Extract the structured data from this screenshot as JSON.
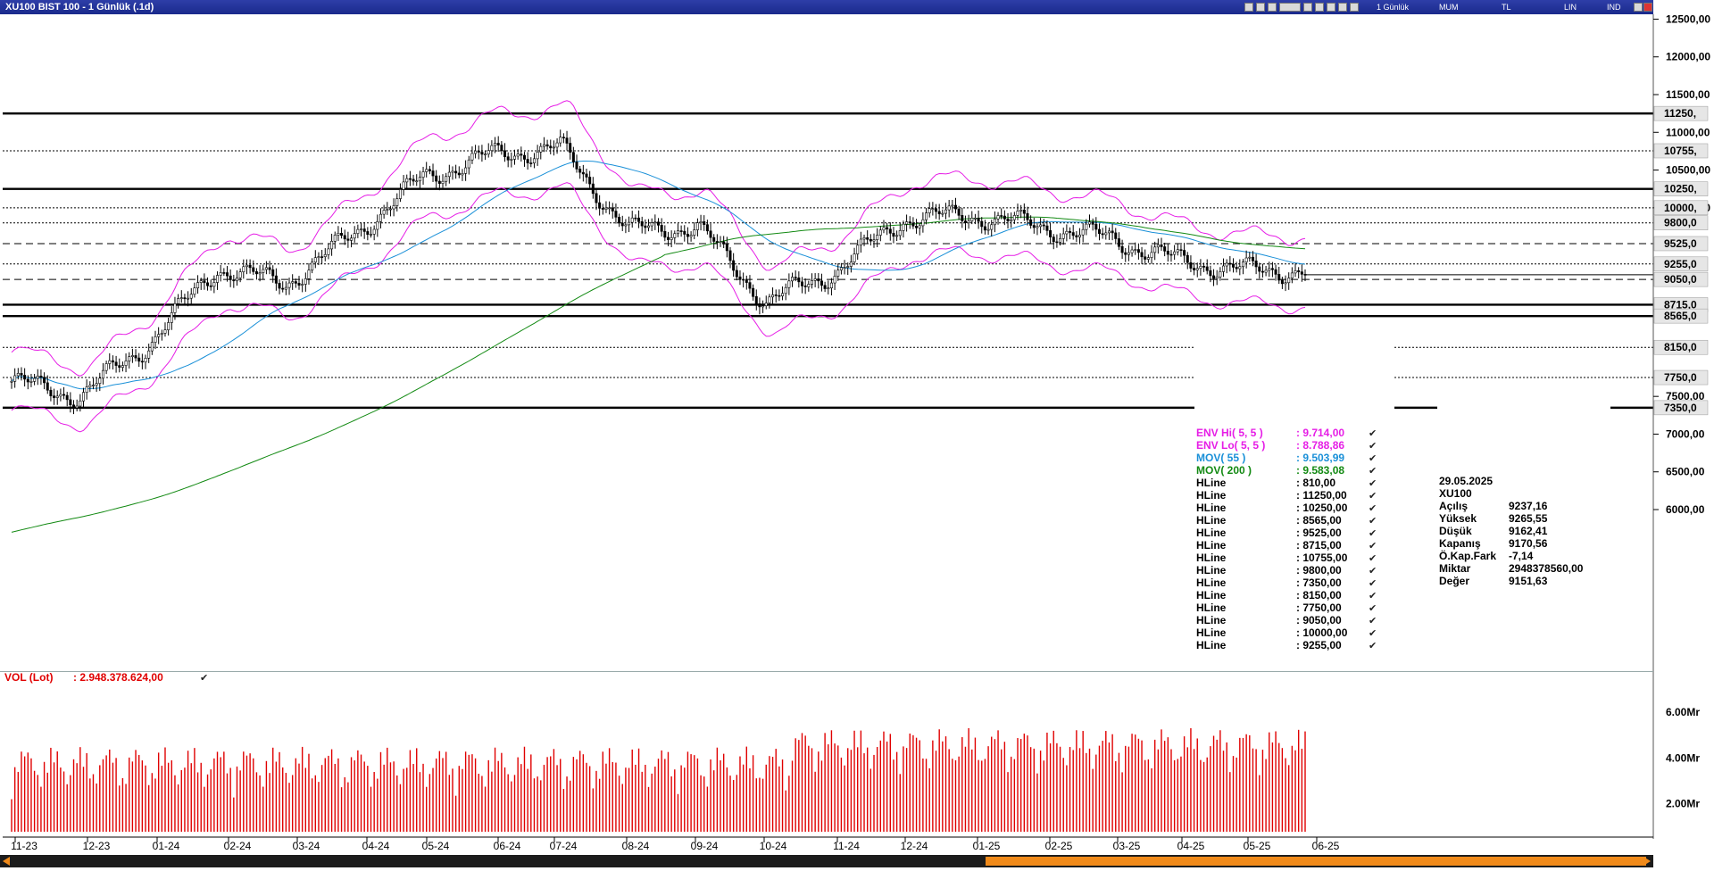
{
  "window": {
    "title": "XU100 BIST 100 - 1 Günlük (.1d)",
    "toolbar_labels": [
      "1 Günlük",
      "MUM",
      "TL",
      "LIN",
      "IND"
    ]
  },
  "chart_data": [
    {
      "type": "candlestick",
      "instrument": "XU100",
      "price_axis_ticks": [
        "12500,00",
        "12000,00",
        "11500,00",
        "11000,00",
        "10500,00",
        "10000,00",
        "7500,00",
        "7000,00",
        "6500,00",
        "6000,00"
      ],
      "x_tick_labels": [
        "11-23",
        "12-23",
        "01-24",
        "02-24",
        "03-24",
        "04-24",
        "05-24",
        "06-24",
        "07-24",
        "08-24",
        "09-24",
        "10-24",
        "11-24",
        "12-24",
        "01-25",
        "02-25",
        "03-25",
        "04-25",
        "05-25",
        "06-25"
      ],
      "ylim": [
        5500,
        12500
      ],
      "monthly_close_estimates": [
        {
          "month": "11-23",
          "close": 7700
        },
        {
          "month": "12-23",
          "close": 7500
        },
        {
          "month": "01-24",
          "close": 8200
        },
        {
          "month": "02-24",
          "close": 9200
        },
        {
          "month": "03-24",
          "close": 9000
        },
        {
          "month": "04-24",
          "close": 9650
        },
        {
          "month": "05-24",
          "close": 10400
        },
        {
          "month": "06-24",
          "close": 10700
        },
        {
          "month": "07-24",
          "close": 10800
        },
        {
          "month": "08-24",
          "close": 9700
        },
        {
          "month": "09-24",
          "close": 9750
        },
        {
          "month": "10-24",
          "close": 8750
        },
        {
          "month": "11-24",
          "close": 9150
        },
        {
          "month": "12-24",
          "close": 9850
        },
        {
          "month": "01-25",
          "close": 9900
        },
        {
          "month": "02-25",
          "close": 9750
        },
        {
          "month": "03-25",
          "close": 9600
        },
        {
          "month": "04-25",
          "close": 9300
        },
        {
          "month": "05-25",
          "close": 9170
        }
      ],
      "hlines": [
        {
          "value": "11250,",
          "style": "thick"
        },
        {
          "value": "10755,",
          "style": "dotted"
        },
        {
          "value": "10250,",
          "style": "thick"
        },
        {
          "value": "10000,",
          "style": "dotted"
        },
        {
          "value": "9800,0",
          "style": "dotted"
        },
        {
          "value": "9525,0",
          "style": "dashed"
        },
        {
          "value": "9255,0",
          "style": "dotted"
        },
        {
          "value": "9050,0",
          "style": "dashed"
        },
        {
          "value": "8715,0",
          "style": "thick"
        },
        {
          "value": "8565,0",
          "style": "thick"
        },
        {
          "value": "8150,0",
          "style": "dotted"
        },
        {
          "value": "7750,0",
          "style": "dotted"
        },
        {
          "value": "7350,0",
          "style": "thick"
        }
      ],
      "indicators": [
        {
          "name": "ENV Hi( 5, 5 )",
          "value": ": 9.714,00",
          "color": "#e61ee6"
        },
        {
          "name": "ENV Lo( 5, 5 )",
          "value": ": 8.788,86",
          "color": "#e61ee6"
        },
        {
          "name": "MOV( 55 )",
          "value": ": 9.503,99",
          "color": "#1a90d8"
        },
        {
          "name": "MOV( 200 )",
          "value": ": 9.583,08",
          "color": "#138a13"
        }
      ],
      "hline_legend": [
        {
          "name": "HLine",
          "value": ": 810,00"
        },
        {
          "name": "HLine",
          "value": ": 11250,00"
        },
        {
          "name": "HLine",
          "value": ": 10250,00"
        },
        {
          "name": "HLine",
          "value": ": 8565,00"
        },
        {
          "name": "HLine",
          "value": ": 9525,00"
        },
        {
          "name": "HLine",
          "value": ": 8715,00"
        },
        {
          "name": "HLine",
          "value": ": 10755,00"
        },
        {
          "name": "HLine",
          "value": ": 9800,00"
        },
        {
          "name": "HLine",
          "value": ": 7350,00"
        },
        {
          "name": "HLine",
          "value": ": 8150,00"
        },
        {
          "name": "HLine",
          "value": ": 7750,00"
        },
        {
          "name": "HLine",
          "value": ": 9050,00"
        },
        {
          "name": "HLine",
          "value": ": 10000,00"
        },
        {
          "name": "HLine",
          "value": ": 9255,00"
        }
      ],
      "colors": {
        "candle": "#000000",
        "envelope": "#e61ee6",
        "mov55": "#1a90d8",
        "mov200": "#138a13"
      }
    },
    {
      "type": "bar",
      "title": "VOL (Lot)",
      "current_value": ": 2.948.378.624,00",
      "ylim": [
        0,
        7.5
      ],
      "y_tick_labels": [
        "6.00Mr",
        "4.00Mr",
        "2.00Mr"
      ],
      "unit": "Mr",
      "color": "#e00000"
    }
  ],
  "data_window": {
    "date": "29.05.2025",
    "symbol": "XU100",
    "rows": [
      {
        "label": "Açılış",
        "value": "9237,16"
      },
      {
        "label": "Yüksek",
        "value": "9265,55"
      },
      {
        "label": "Düşük",
        "value": "9162,41"
      },
      {
        "label": "Kapanış",
        "value": "9170,56"
      },
      {
        "label": "Ö.Kap.Fark",
        "value": "-7,14"
      },
      {
        "label": "Miktar",
        "value": "2948378560,00"
      },
      {
        "label": "Değer",
        "value": "9151,63"
      }
    ]
  }
}
